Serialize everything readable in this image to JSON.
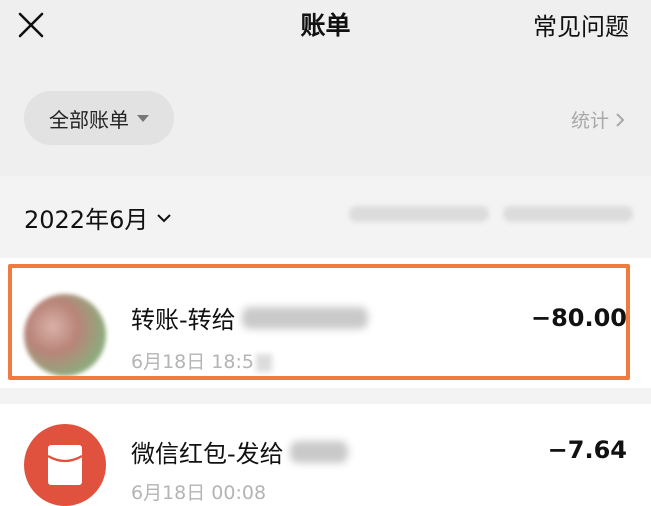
{
  "header": {
    "title": "账单",
    "help_label": "常见问题"
  },
  "filter": {
    "label": "全部账单",
    "stats_label": "统计"
  },
  "month": {
    "label": "2022年6月"
  },
  "transactions": [
    {
      "title": "转账-转给",
      "time": "6月18日 18:5",
      "amount": "−80.00",
      "highlighted": true
    },
    {
      "title": "微信红包-发给",
      "time": "6月18日 00:08",
      "amount": "−7.64",
      "icon": "red-envelope-icon"
    }
  ],
  "colors": {
    "header_bg": "#efefef",
    "highlight_border": "#f07b3f",
    "red_envelope": "#e0523d"
  }
}
